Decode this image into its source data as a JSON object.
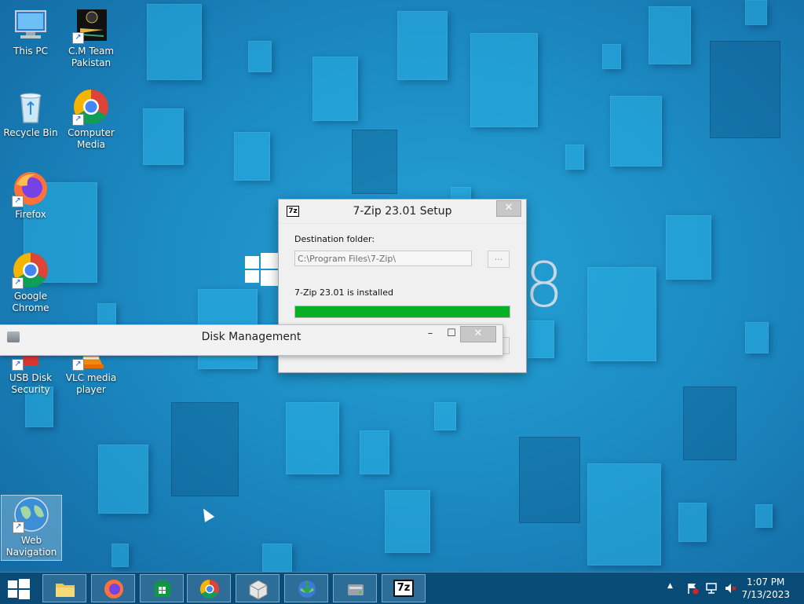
{
  "desktop": {
    "icons": [
      {
        "label": "This PC"
      },
      {
        "label": "C.M Team Pakistan"
      },
      {
        "label": "Recycle Bin"
      },
      {
        "label": "Computer Media"
      },
      {
        "label": "Firefox"
      },
      {
        "label": "Google Chrome"
      },
      {
        "label": "USB Disk Security"
      },
      {
        "label": "VLC media player"
      },
      {
        "label": "Web Navigation"
      }
    ],
    "watermark_digit": "8"
  },
  "setup_dialog": {
    "title": "7-Zip 23.01 Setup",
    "app_icon_text": "7z",
    "close_symbol": "✕",
    "destination_label": "Destination folder:",
    "destination_path": "C:\\Program Files\\7-Zip\\",
    "browse_label": "...",
    "status_text": "7-Zip 23.01 is installed",
    "progress_percent": 100,
    "progress_color": "#06b025"
  },
  "disk_management": {
    "title": "Disk Management",
    "minimize_symbol": "–",
    "maximize_symbol": "☐",
    "close_symbol": "✕"
  },
  "taskbar": {
    "apps": [
      {
        "name": "file-explorer-icon"
      },
      {
        "name": "firefox-icon"
      },
      {
        "name": "store-icon"
      },
      {
        "name": "chrome-icon"
      },
      {
        "name": "app-cube-icon"
      },
      {
        "name": "internet-download-manager-icon"
      },
      {
        "name": "disk-management-icon"
      },
      {
        "name": "7zip-icon",
        "text": "7z"
      }
    ],
    "tray": {
      "chevron": "▲",
      "time": "1:07 PM",
      "date": "7/13/2023"
    }
  }
}
